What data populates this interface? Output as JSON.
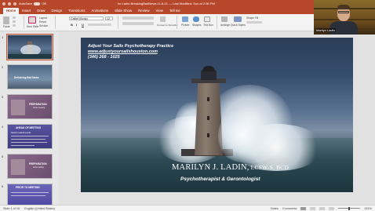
{
  "window": {
    "autosave_label": "AutoSave",
    "autosave_state": "Off",
    "title": "Ivr Ladin.BreakingBadNews.11-8-21 — Last Modified: Sun at 2:36 PM",
    "accent": "#b7472a"
  },
  "ribbon": {
    "tabs": [
      "Home",
      "Insert",
      "Draw",
      "Design",
      "Transitions",
      "Animations",
      "Slide Show",
      "Review",
      "View",
      "Tell me"
    ],
    "active_tab": "Home",
    "font_name": "Calibri (Body)",
    "font_size": "12",
    "paste_label": "Paste",
    "new_slide_label": "New Slide",
    "layout_label": "Layout",
    "reset_label": "Reset",
    "section_label": "Section",
    "format_buttons": [
      "B",
      "I",
      "U"
    ],
    "convert_label": "Convert to SmartArt",
    "picture_label": "Picture",
    "shapes_label": "Shapes",
    "textbox_label": "Text Box",
    "arrange_label": "Arrange",
    "quick_styles_label": "Quick Styles",
    "shape_fill_label": "Shape Fill"
  },
  "thumbnails": [
    {
      "num": "1",
      "title": "",
      "sub": "",
      "bg": "#3f5a78",
      "selected": true
    },
    {
      "num": "2",
      "title": "Delivering Bad News",
      "sub": "",
      "bg": "#5c7898",
      "selected": false
    },
    {
      "num": "3",
      "title": "PREPARATION",
      "sub": "of the meeting",
      "bg": "#7a5c7a",
      "selected": false
    },
    {
      "num": "4",
      "title": "AHEAD OF MEETING",
      "sub": "Review medical records",
      "bg": "#4c4a8a",
      "selected": false
    },
    {
      "num": "5",
      "title": "PREPARATION",
      "sub": "of the setting",
      "bg": "#7a5c7a",
      "selected": false
    },
    {
      "num": "6",
      "title": "PRIOR TO MEETING",
      "sub": "",
      "bg": "#5a55a0",
      "selected": false
    }
  ],
  "slide": {
    "line1": "Adjust Your Sails Psychotherapy Practice",
    "line2": "www.adjustyoursailshouston.com",
    "line3": "(346) 268 - 1025",
    "name_main": "MARILYN J. LADIN,",
    "name_creds": " LCSW-S, BCD",
    "role": "Psychotherapist & Gerontologist"
  },
  "statusbar": {
    "slide_info": "Slide 1 of 16",
    "language": "English (United States)",
    "notes_label": "Notes",
    "comments_label": "Comments",
    "zoom": "151%"
  },
  "webcam": {
    "label": "Marilyn Ladin"
  }
}
